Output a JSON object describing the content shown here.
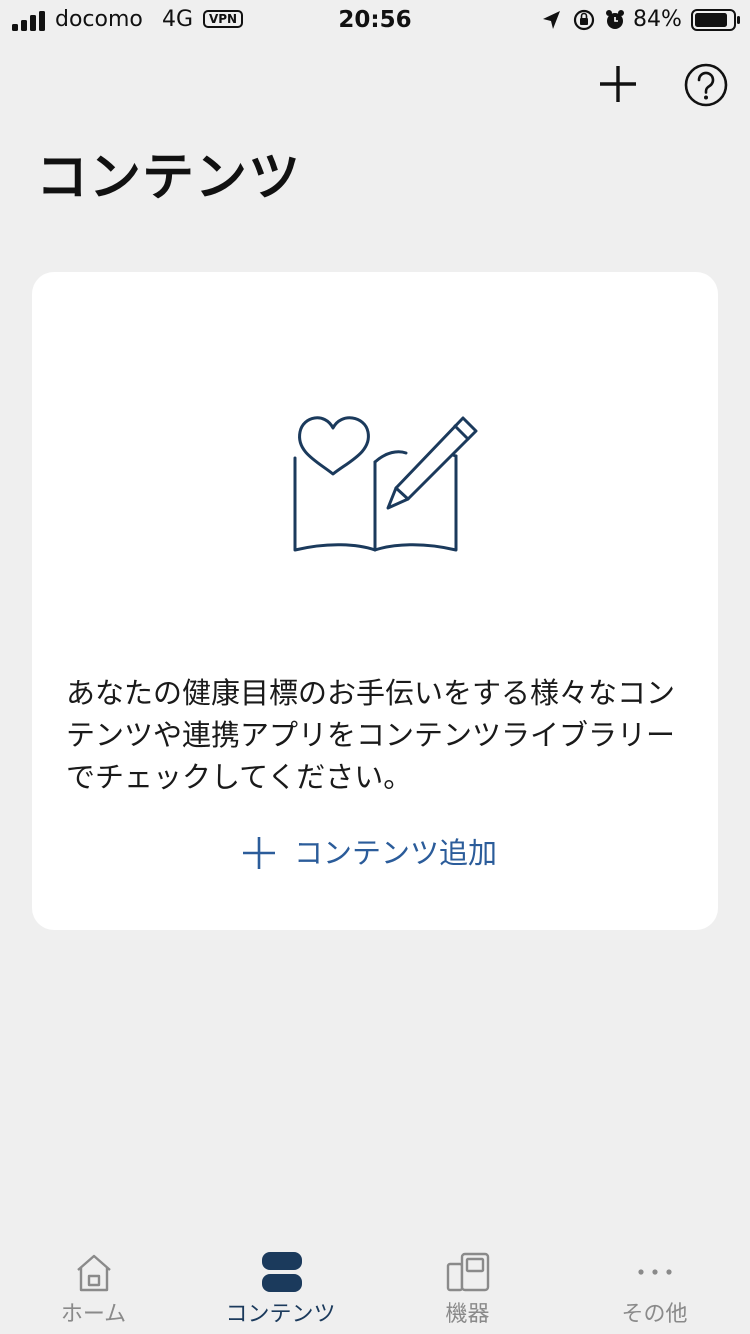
{
  "status_bar": {
    "carrier": "docomo",
    "network": "4G",
    "vpn": "VPN",
    "time": "20:56",
    "battery_percent": "84%"
  },
  "header": {
    "title": "コンテンツ"
  },
  "card": {
    "illustration": "book-heart-pencil-icon",
    "description": "あなたの健康目標のお手伝いをする様々なコンテンツや連携アプリをコンテンツライブラリーでチェックしてください。",
    "add_link_label": "コンテンツ追加"
  },
  "tabs": [
    {
      "label": "ホーム",
      "icon": "home-icon",
      "active": false
    },
    {
      "label": "コンテンツ",
      "icon": "contents-icon",
      "active": true
    },
    {
      "label": "機器",
      "icon": "devices-icon",
      "active": false
    },
    {
      "label": "その他",
      "icon": "more-icon",
      "active": false
    }
  ],
  "colors": {
    "background": "#efefef",
    "card": "#ffffff",
    "accent": "#2b5c9a",
    "active_tab": "#1b3a5c",
    "inactive_tab": "#8a8a8a"
  }
}
